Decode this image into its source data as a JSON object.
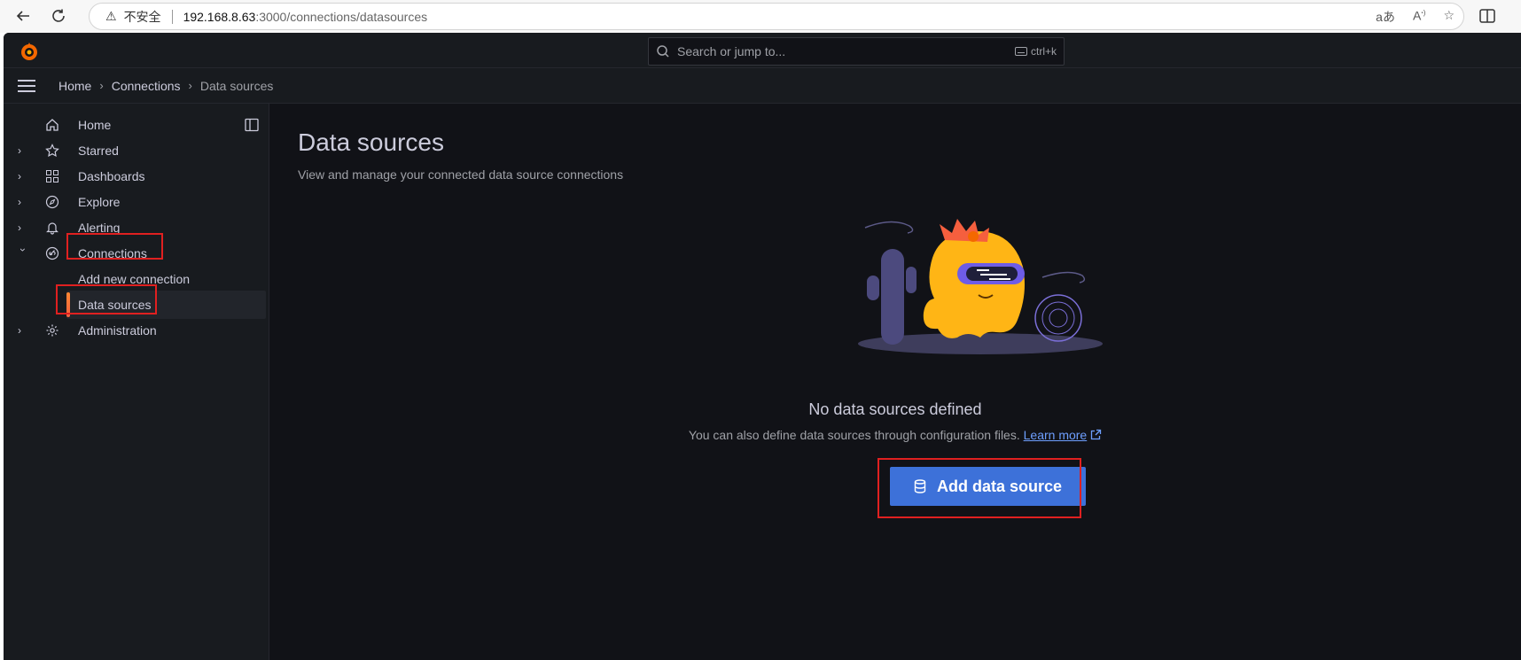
{
  "browser": {
    "insecure_label": "不安全",
    "url_host": "192.168.8.63",
    "url_path": ":3000/connections/datasources"
  },
  "topbar": {
    "search_placeholder": "Search or jump to...",
    "search_shortcut": "ctrl+k"
  },
  "breadcrumb": {
    "items": [
      "Home",
      "Connections",
      "Data sources"
    ]
  },
  "sidebar": {
    "items": [
      {
        "label": "Home",
        "icon": "home-icon"
      },
      {
        "label": "Starred",
        "icon": "star-icon"
      },
      {
        "label": "Dashboards",
        "icon": "apps-icon"
      },
      {
        "label": "Explore",
        "icon": "compass-icon"
      },
      {
        "label": "Alerting",
        "icon": "bell-icon"
      },
      {
        "label": "Connections",
        "icon": "link-icon"
      },
      {
        "label": "Administration",
        "icon": "cog-icon"
      }
    ],
    "sub_items": [
      {
        "label": "Add new connection"
      },
      {
        "label": "Data sources"
      }
    ]
  },
  "main": {
    "title": "Data sources",
    "subtitle": "View and manage your connected data source connections",
    "empty_title": "No data sources defined",
    "empty_text": "You can also define data sources through configuration files.",
    "learn_more": "Learn more",
    "add_button": "Add data source"
  },
  "colors": {
    "primary_button": "#3d71d9",
    "highlight": "#e02020",
    "active_bar": "#ff8833"
  }
}
